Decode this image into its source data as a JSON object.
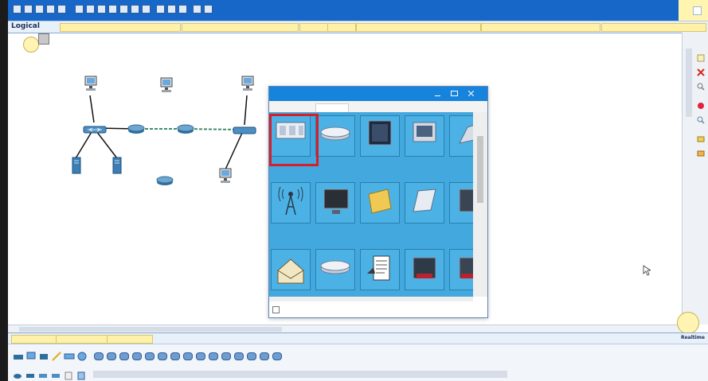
{
  "window": {
    "view_label": "Logical",
    "top_bar_fields": [
      "",
      "",
      "",
      "",
      "",
      "",
      "",
      ""
    ],
    "status_fields": [
      "",
      "",
      ""
    ],
    "mode_label": "Realtime"
  },
  "canvas_labels": [
    "",
    "",
    "",
    "",
    "",
    "",
    "",
    "",
    "",
    "",
    "",
    ""
  ],
  "packet_window": {
    "title": "",
    "tabs": [
      "",
      "",
      "",
      ""
    ],
    "tiles": [
      {
        "icon": "web-icon",
        "label": ""
      },
      {
        "icon": "router-flat-icon",
        "label": ""
      },
      {
        "icon": "monitor-icon",
        "label": ""
      },
      {
        "icon": "tablet-icon",
        "label": ""
      },
      {
        "icon": "device-icon",
        "label": ""
      },
      {
        "icon": "wireless-tower-icon",
        "label": ""
      },
      {
        "icon": "tv-icon",
        "label": ""
      },
      {
        "icon": "sticky-note-icon",
        "label": ""
      },
      {
        "icon": "scanner-icon",
        "label": ""
      },
      {
        "icon": "device-icon",
        "label": ""
      },
      {
        "icon": "email-icon",
        "label": ""
      },
      {
        "icon": "router-flat-icon",
        "label": ""
      },
      {
        "icon": "document-icon",
        "label": ""
      },
      {
        "icon": "alarm-icon",
        "label": ""
      },
      {
        "icon": "device-icon",
        "label": ""
      }
    ],
    "checkbox_label": ""
  },
  "colors": {
    "titlebar": "#1667c8",
    "tile_bg": "#42a8dd",
    "highlight": "#d4202a"
  }
}
